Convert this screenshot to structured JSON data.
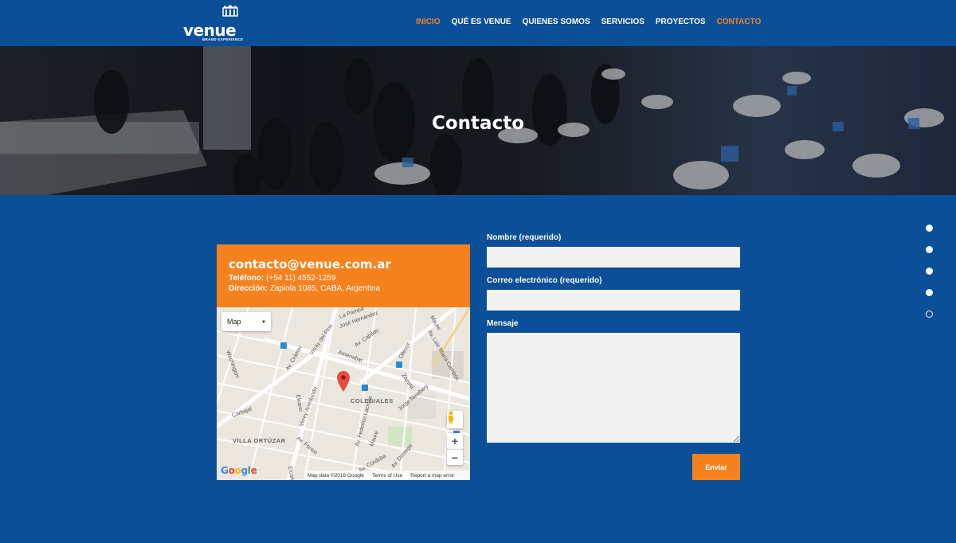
{
  "brand": {
    "name": "venue",
    "tagline": "BRAND EXPERIENCE"
  },
  "nav": [
    {
      "label": "INICIO",
      "active": true
    },
    {
      "label": "QUÉ ES VENUE",
      "active": false
    },
    {
      "label": "QUIENES SOMOS",
      "active": false
    },
    {
      "label": "SERVICIOS",
      "active": false
    },
    {
      "label": "PROYECTOS",
      "active": false
    },
    {
      "label": "CONTACTO",
      "active": true
    }
  ],
  "hero": {
    "title": "Contacto"
  },
  "contact": {
    "email": "contacto@venue.com.ar",
    "phone_label": "Teléfono:",
    "phone": "(+54 11) 4552-1259",
    "address_label": "Dirección:",
    "address": "Zapiola 1085, CABA, Argentina"
  },
  "map": {
    "type_selector": "Map",
    "streets": [
      "La Pampa",
      "José Hernández",
      "Av. Cabildo",
      "Virrey del Pino",
      "Av. Crámer",
      "Amenabar",
      "Olleros",
      "Av. Luis María Campos",
      "Maure",
      "Washington",
      "Zapata",
      "Jorge Newbery",
      "Elcano",
      "Virrey Arredondo",
      "Av. Federico Lacroze",
      "Carbajal",
      "Av. Forest",
      "Av. Dorrego",
      "Av. Córdoba"
    ],
    "neighborhoods": [
      "COLEGIALES",
      "VILLA ORTÚZAR"
    ],
    "zoom_in": "+",
    "zoom_out": "−",
    "logo": "Google",
    "footer": [
      "Map data ©2016 Google",
      "Terms of Use",
      "Report a map error"
    ]
  },
  "form": {
    "name_label": "Nombre (requerido)",
    "email_label": "Correo electrónico (requerido)",
    "message_label": "Mensaje",
    "submit_label": "Enviar"
  },
  "colors": {
    "primary": "#0a4f97",
    "accent": "#f5821f",
    "input_bg": "#f1f1f1"
  }
}
